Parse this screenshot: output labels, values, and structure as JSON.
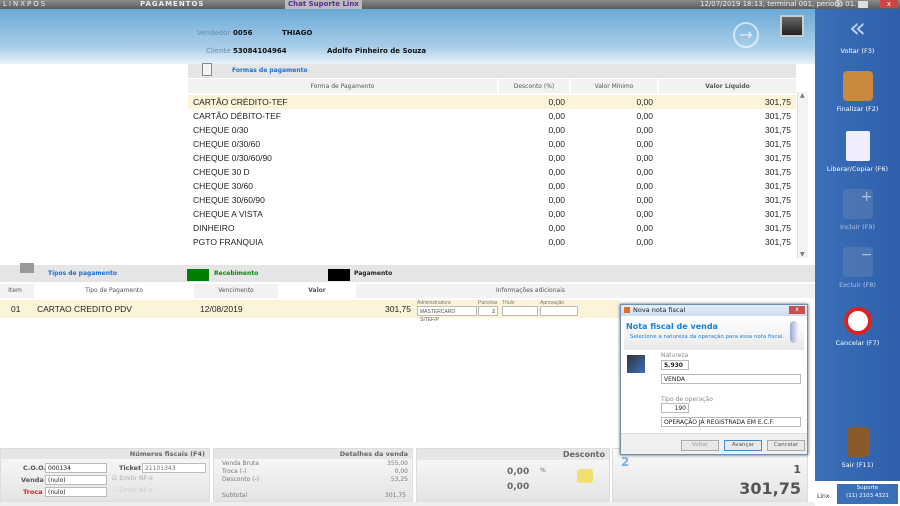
{
  "topbar": {
    "app": "LINXPOS",
    "title": "PAGAMENTOS",
    "chat": "Chat Suporte Linx",
    "status": "12/07/2019 18:13, terminal 001, período 01."
  },
  "header": {
    "vendedor_label": "Vendedor",
    "vendedor_code": "0056",
    "vendedor_name": "THIAGO",
    "cliente_label": "Cliente",
    "cliente_code": "53084104964",
    "cliente_name": "Adolfo Pinheiro de Souza"
  },
  "payment_forms": {
    "title": "Formas de pagamento",
    "columns": [
      "Forma de Pagamento",
      "Desconto (%)",
      "Valor Mínimo",
      "Valor Líquido"
    ],
    "rows": [
      [
        "CARTÃO CRÉDITO-TEF",
        "0,00",
        "0,00",
        "301,75"
      ],
      [
        "CARTÃO DÉBITO-TEF",
        "0,00",
        "0,00",
        "301,75"
      ],
      [
        "CHEQUE 0/30",
        "0,00",
        "0,00",
        "301,75"
      ],
      [
        "CHEQUE 0/30/60",
        "0,00",
        "0,00",
        "301,75"
      ],
      [
        "CHEQUE 0/30/60/90",
        "0,00",
        "0,00",
        "301,75"
      ],
      [
        "CHEQUE 30 D",
        "0,00",
        "0,00",
        "301,75"
      ],
      [
        "CHEQUE 30/60",
        "0,00",
        "0,00",
        "301,75"
      ],
      [
        "CHEQUE 30/60/90",
        "0,00",
        "0,00",
        "301,75"
      ],
      [
        "CHEQUE A VISTA",
        "0,00",
        "0,00",
        "301,75"
      ],
      [
        "DINHEIRO",
        "0,00",
        "0,00",
        "301,75"
      ],
      [
        "PGTO FRANQUIA",
        "0,00",
        "0,00",
        "301,75"
      ]
    ]
  },
  "payment_types": {
    "title": "Tipos de pagamento",
    "legend_receipt": "Recebimento",
    "legend_payment": "Pagamento",
    "receipt_color": "#008000",
    "payment_color": "#000000",
    "columns": [
      "Item",
      "Tipo de Pagamento",
      "Vencimento",
      "Valor",
      "Informações adicionais"
    ],
    "row": {
      "item": "01",
      "type": "CARTAO CREDITO PDV",
      "due": "12/08/2019",
      "value": "301,75",
      "admin_label": "Administradora",
      "admin": "MASTERCARD SITEF/P",
      "parcelas_label": "Parcelas",
      "parcelas": "2",
      "titulo_label": "Título",
      "aprovacao_label": "Aprovação"
    }
  },
  "dialog": {
    "window_title": "Nova nota fiscal",
    "heading": "Nota fiscal de venda",
    "subtitle": "Selecione a natureza da operação para essa nota fiscal.",
    "natureza_label": "Natureza",
    "natureza": "5.930",
    "natureza_desc": "VENDA",
    "tipo_label": "Tipo de operação",
    "tipo": "190",
    "tipo_desc": "OPERAÇÃO JÁ REGISTRADA EM E.C.F.",
    "back": "Voltar",
    "next": "Avançar",
    "cancel": "Cancelar"
  },
  "fiscal": {
    "title": "Números fiscais (F4)",
    "coo_label": "C.O.O.",
    "coo": "000134",
    "ticket_label": "Ticket",
    "ticket": "21101343",
    "venda_label": "Venda",
    "venda": "(nulo)",
    "troca_label": "Troca",
    "troca": "(nulo)",
    "emit1": "Emitir NF-e",
    "emit2": "Emitir NF-e"
  },
  "details": {
    "title": "Detalhes da venda",
    "rows": [
      [
        "Venda Bruta",
        "355,00"
      ],
      [
        "Troca (-)",
        "0,00"
      ],
      [
        "Desconto (-)",
        "53,25"
      ]
    ],
    "subtotal_label": "Subtotal",
    "subtotal": "301,75"
  },
  "discount": {
    "title": "Desconto",
    "percent": "0,00",
    "percent_sign": "%",
    "value": "0,00"
  },
  "total": {
    "count": "1",
    "value": "301,75",
    "step": "2"
  },
  "sidebar": {
    "buttons": [
      "Voltar (F3)",
      "Finalizar (F2)",
      "Liberar/Copiar (F6)",
      "Incluir (F9)",
      "Excluir (F8)",
      "Cancelar (F7)",
      "Sair (F11)"
    ],
    "support": "Suporte",
    "phone": "(11) 2103 4321",
    "logo": "Linx"
  }
}
